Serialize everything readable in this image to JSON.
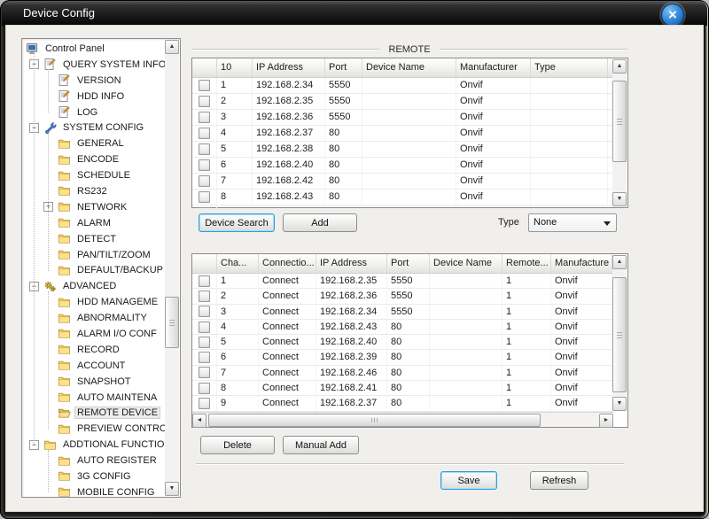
{
  "window": {
    "title": "Device Config",
    "close_glyph": "×"
  },
  "icons": {
    "up": "▲",
    "down": "▼",
    "left": "◄",
    "right": "►"
  },
  "tree": {
    "items": [
      {
        "label": "Control Panel",
        "level": 0,
        "icon": "computer",
        "expander": null,
        "selected": false
      },
      {
        "label": "QUERY SYSTEM INFO",
        "level": 1,
        "icon": "notepad",
        "expander": "minus",
        "selected": false
      },
      {
        "label": "VERSION",
        "level": 2,
        "icon": "notepad",
        "expander": null,
        "selected": false
      },
      {
        "label": "HDD INFO",
        "level": 2,
        "icon": "notepad",
        "expander": null,
        "selected": false
      },
      {
        "label": "LOG",
        "level": 2,
        "icon": "notepad",
        "expander": null,
        "selected": false
      },
      {
        "label": "SYSTEM CONFIG",
        "level": 1,
        "icon": "tools",
        "expander": "minus",
        "selected": false
      },
      {
        "label": "GENERAL",
        "level": 2,
        "icon": "folder",
        "expander": null,
        "selected": false
      },
      {
        "label": "ENCODE",
        "level": 2,
        "icon": "folder",
        "expander": null,
        "selected": false
      },
      {
        "label": "SCHEDULE",
        "level": 2,
        "icon": "folder",
        "expander": null,
        "selected": false
      },
      {
        "label": "RS232",
        "level": 2,
        "icon": "folder",
        "expander": null,
        "selected": false
      },
      {
        "label": "NETWORK",
        "level": 2,
        "icon": "folder",
        "expander": "plus",
        "selected": false
      },
      {
        "label": "ALARM",
        "level": 2,
        "icon": "folder",
        "expander": null,
        "selected": false
      },
      {
        "label": "DETECT",
        "level": 2,
        "icon": "folder",
        "expander": null,
        "selected": false
      },
      {
        "label": "PAN/TILT/ZOOM",
        "level": 2,
        "icon": "folder",
        "expander": null,
        "selected": false
      },
      {
        "label": "DEFAULT/BACKUP",
        "level": 2,
        "icon": "folder",
        "expander": null,
        "selected": false
      },
      {
        "label": "ADVANCED",
        "level": 1,
        "icon": "gears",
        "expander": "minus",
        "selected": false
      },
      {
        "label": "HDD MANAGEME",
        "level": 2,
        "icon": "folder",
        "expander": null,
        "selected": false
      },
      {
        "label": "ABNORMALITY",
        "level": 2,
        "icon": "folder",
        "expander": null,
        "selected": false
      },
      {
        "label": "ALARM I/O CONF",
        "level": 2,
        "icon": "folder",
        "expander": null,
        "selected": false
      },
      {
        "label": "RECORD",
        "level": 2,
        "icon": "folder",
        "expander": null,
        "selected": false
      },
      {
        "label": "ACCOUNT",
        "level": 2,
        "icon": "folder",
        "expander": null,
        "selected": false
      },
      {
        "label": "SNAPSHOT",
        "level": 2,
        "icon": "folder",
        "expander": null,
        "selected": false
      },
      {
        "label": "AUTO MAINTENA",
        "level": 2,
        "icon": "folder",
        "expander": null,
        "selected": false
      },
      {
        "label": "REMOTE DEVICE",
        "level": 2,
        "icon": "folder-open",
        "expander": null,
        "selected": true
      },
      {
        "label": "PREVIEW CONTRO",
        "level": 2,
        "icon": "folder",
        "expander": null,
        "selected": false
      },
      {
        "label": "ADDTIONAL FUNCTIO",
        "level": 1,
        "icon": "folder",
        "expander": "minus",
        "selected": false
      },
      {
        "label": "AUTO REGISTER",
        "level": 2,
        "icon": "folder",
        "expander": null,
        "selected": false
      },
      {
        "label": "3G CONFIG",
        "level": 2,
        "icon": "folder",
        "expander": null,
        "selected": false
      },
      {
        "label": "MOBILE CONFIG",
        "level": 2,
        "icon": "folder",
        "expander": null,
        "selected": false
      }
    ]
  },
  "remote_group": {
    "label": "REMOTE"
  },
  "search_table": {
    "headers": [
      "",
      "10",
      "IP Address",
      "Port",
      "Device Name",
      "Manufacturer",
      "Type"
    ],
    "rows": [
      [
        "1",
        "192.168.2.34",
        "5550",
        "",
        "Onvif",
        ""
      ],
      [
        "2",
        "192.168.2.35",
        "5550",
        "",
        "Onvif",
        ""
      ],
      [
        "3",
        "192.168.2.36",
        "5550",
        "",
        "Onvif",
        ""
      ],
      [
        "4",
        "192.168.2.37",
        "80",
        "",
        "Onvif",
        ""
      ],
      [
        "5",
        "192.168.2.38",
        "80",
        "",
        "Onvif",
        ""
      ],
      [
        "6",
        "192.168.2.40",
        "80",
        "",
        "Onvif",
        ""
      ],
      [
        "7",
        "192.168.2.42",
        "80",
        "",
        "Onvif",
        ""
      ],
      [
        "8",
        "192.168.2.43",
        "80",
        "",
        "Onvif",
        ""
      ]
    ]
  },
  "toolbar": {
    "device_search": "Device Search",
    "add": "Add",
    "type_label": "Type",
    "type_value": "None"
  },
  "device_table": {
    "headers": [
      "",
      "Cha...",
      "Connectio...",
      "IP Address",
      "Port",
      "Device Name",
      "Remote...",
      "Manufacture"
    ],
    "rows": [
      [
        "1",
        "Connect",
        "192.168.2.35",
        "5550",
        "",
        "1",
        "Onvif"
      ],
      [
        "2",
        "Connect",
        "192.168.2.36",
        "5550",
        "",
        "1",
        "Onvif"
      ],
      [
        "3",
        "Connect",
        "192.168.2.34",
        "5550",
        "",
        "1",
        "Onvif"
      ],
      [
        "4",
        "Connect",
        "192.168.2.43",
        "80",
        "",
        "1",
        "Onvif"
      ],
      [
        "5",
        "Connect",
        "192.168.2.40",
        "80",
        "",
        "1",
        "Onvif"
      ],
      [
        "6",
        "Connect",
        "192.168.2.39",
        "80",
        "",
        "1",
        "Onvif"
      ],
      [
        "7",
        "Connect",
        "192.168.2.46",
        "80",
        "",
        "1",
        "Onvif"
      ],
      [
        "8",
        "Connect",
        "192.168.2.41",
        "80",
        "",
        "1",
        "Onvif"
      ],
      [
        "9",
        "Connect",
        "192.168.2.37",
        "80",
        "",
        "1",
        "Onvif"
      ]
    ]
  },
  "actions": {
    "delete": "Delete",
    "manual_add": "Manual Add",
    "save": "Save",
    "refresh": "Refresh"
  }
}
